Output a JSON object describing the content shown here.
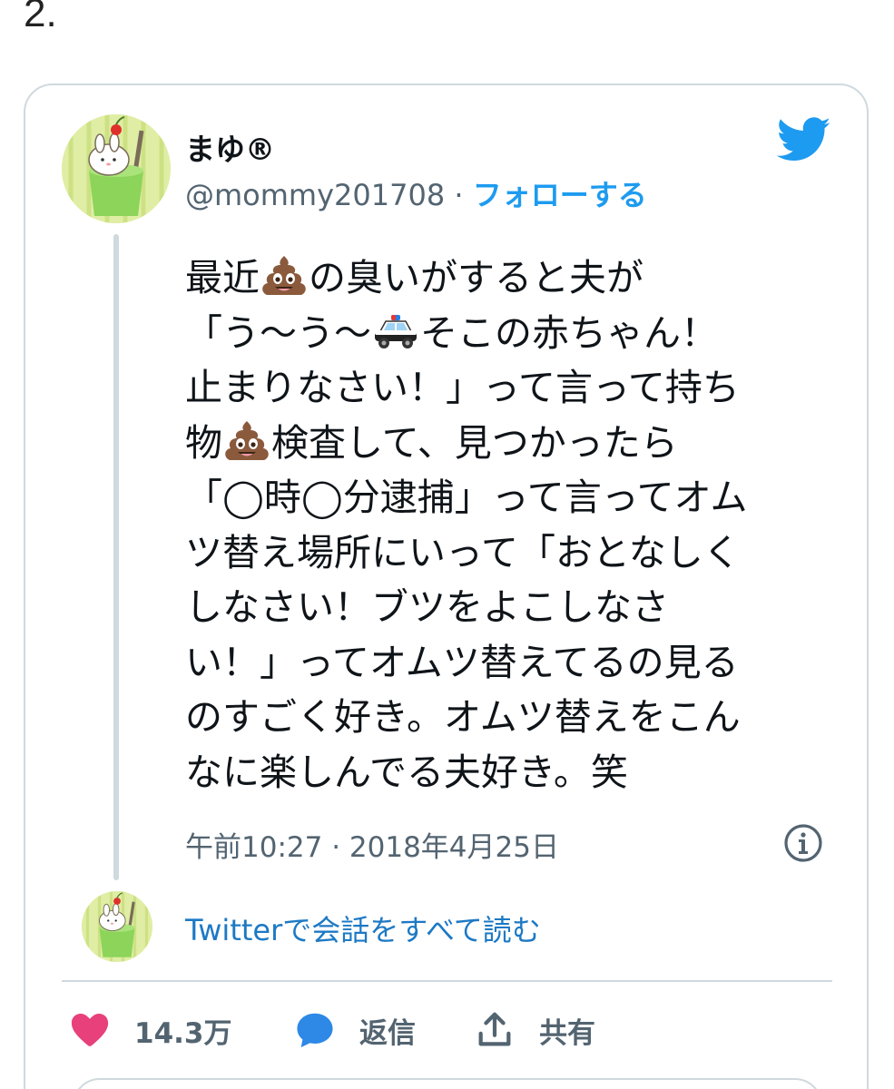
{
  "page_number": "2.",
  "author": {
    "display_name": "まゆ®",
    "handle": "@mommy201708",
    "separator": " · ",
    "follow_label": "フォローする"
  },
  "tweet": {
    "lines": [
      [
        "最近",
        "poop-emoji",
        "の臭いがすると夫が"
      ],
      [
        "「う〜う〜",
        "police-car-emoji",
        "そこの赤ちゃん！"
      ],
      [
        "止まりなさい！」って言って持ち"
      ],
      [
        "物",
        "poop-emoji",
        "検査して、見つかったら"
      ],
      [
        "「◯時◯分逮捕」って言ってオム"
      ],
      [
        "ツ替え場所にいって「おとなしく"
      ],
      [
        "しなさい！ブツをよこしなさ"
      ],
      [
        "い！」ってオムツ替えてるの見る"
      ],
      [
        "のすごく好き。オムツ替えをこん"
      ],
      [
        "なに楽しんでる夫好き。笑"
      ]
    ],
    "line_1_a": "最近",
    "line_1_b": "の臭いがすると夫が",
    "line_2_a": "「う〜う〜",
    "line_2_b": "そこの赤ちゃん！",
    "line_3": "止まりなさい！」って言って持ち",
    "line_4_a": "物",
    "line_4_b": "検査して、見つかったら",
    "line_5": "「◯時◯分逮捕」って言ってオム",
    "line_6": "ツ替え場所にいって「おとなしく",
    "line_7": "しなさい！ブツをよこしなさ",
    "line_8": "い！」ってオムツ替えてるの見る",
    "line_9": "のすごく好き。オムツ替えをこん",
    "line_10": "なに楽しんでる夫好き。笑",
    "timestamp": "午前10:27 · 2018年4月25日"
  },
  "read_all_label": "Twitterで会話をすべて読む",
  "actions": {
    "like_count": "14.3万",
    "reply_label": "返信",
    "share_label": "共有"
  },
  "icons": {
    "brand": "twitter-bird-icon",
    "info": "info-icon",
    "like": "heart-icon",
    "reply": "speech-bubble-icon",
    "share": "share-icon"
  },
  "colors": {
    "twitter_blue": "#1d9bf0",
    "link_blue": "#1d79c4",
    "heart_pink": "#e8407a",
    "reply_blue": "#2d88e6",
    "text_gray": "#536471",
    "border_gray": "#cfd9de"
  }
}
